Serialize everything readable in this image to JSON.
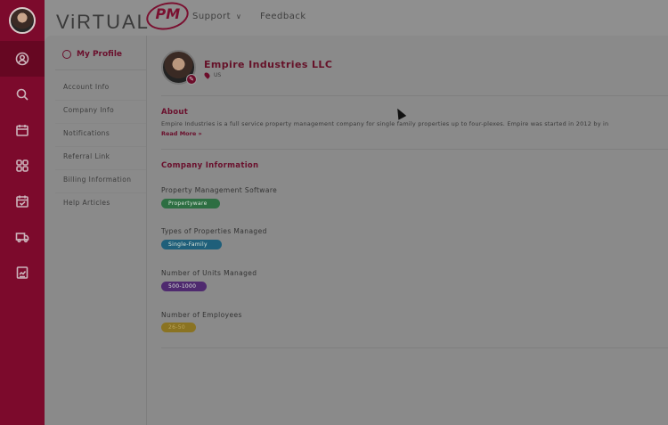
{
  "app": {
    "logo_text": "ViRTUAL",
    "logo_suffix": "PM"
  },
  "topnav": {
    "support": "Support",
    "feedback": "Feedback"
  },
  "sidebar_icons": [
    "user-circle-icon",
    "search-icon",
    "calendar-icon",
    "grid-icon",
    "calendar-check-icon",
    "truck-icon",
    "report-icon"
  ],
  "subnav": {
    "header": "My Profile",
    "items": [
      "Account Info",
      "Company Info",
      "Notifications",
      "Referral Link",
      "Billing Information",
      "Help Articles"
    ]
  },
  "company": {
    "name": "Empire Industries LLC",
    "location": "US"
  },
  "about": {
    "title": "About",
    "text": "Empire Industries is a full service property management company for single family properties up to four-plexes. Empire was started in 2012 by in",
    "read_more": "Read More »"
  },
  "company_info": {
    "title": "Company Information",
    "fields": [
      {
        "label": "Property Management Software",
        "value": "Propertyware",
        "color": "#2d6e42"
      },
      {
        "label": "Types of Properties Managed",
        "value": "Single-Family",
        "color": "#1f5f7a"
      },
      {
        "label": "Number of Units Managed",
        "value": "500-1000",
        "color": "#4f2a6f"
      },
      {
        "label": "Number of Employees",
        "value": "26-50",
        "color": "#8a7322"
      }
    ]
  },
  "colors": {
    "rail": "#7c0a2c",
    "accent": "#6a0f2c",
    "overlay_bg": "#8f8f8f"
  }
}
